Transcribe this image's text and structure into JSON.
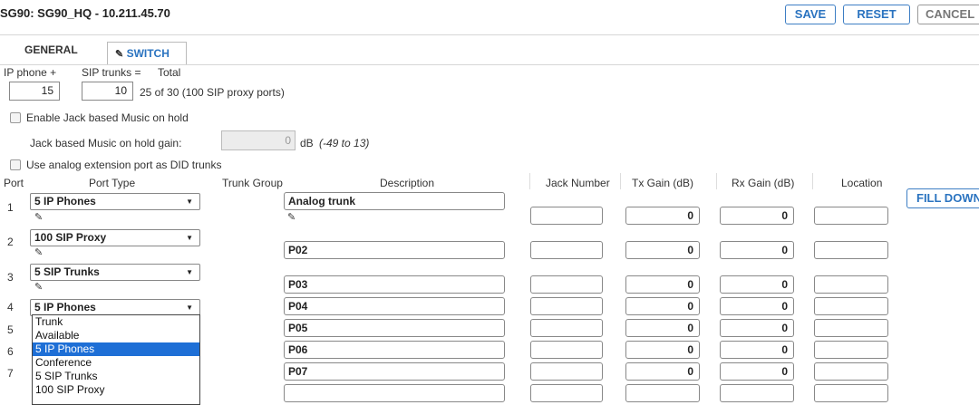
{
  "header": {
    "title": "SG90: SG90_HQ - 10.211.45.70"
  },
  "toolbar": {
    "save": "SAVE",
    "reset": "RESET",
    "cancel": "CANCEL"
  },
  "tabs": {
    "general": "GENERAL",
    "switch": "SWITCH"
  },
  "capacity": {
    "ip_phone_label": "IP phone +",
    "sip_trunks_label": "SIP trunks =",
    "total_label": "Total",
    "ip_phone_value": "15",
    "sip_trunks_value": "10",
    "total_text": "25 of 30 (100 SIP proxy ports)"
  },
  "options": {
    "jack_moh": "Enable Jack based Music on hold",
    "jack_moh_gain_label": "Jack based Music on hold gain:",
    "jack_moh_gain_value": "0",
    "db_unit": "dB",
    "db_range": "(-49 to 13)",
    "analog_did": "Use analog extension port as DID trunks"
  },
  "columns": {
    "port": "Port",
    "port_type": "Port Type",
    "trunk_group": "Trunk Group",
    "description": "Description",
    "jack_number": "Jack Number",
    "tx_gain": "Tx Gain (dB)",
    "rx_gain": "Rx Gain (dB)",
    "location": "Location"
  },
  "fill_down": "FILL DOWN",
  "rows": [
    {
      "port": "1",
      "type": "5 IP Phones",
      "description": "Analog trunk",
      "tx": "0",
      "rx": "0"
    },
    {
      "port": "2",
      "type": "100 SIP Proxy",
      "description": "P02",
      "tx": "0",
      "rx": "0"
    },
    {
      "port": "3",
      "type": "5 SIP Trunks",
      "description": "P03",
      "tx": "0",
      "rx": "0"
    },
    {
      "port": "4",
      "type": "5 IP Phones",
      "description": "P04",
      "tx": "0",
      "rx": "0"
    },
    {
      "port": "5",
      "description": "P05",
      "tx": "0",
      "rx": "0"
    },
    {
      "port": "6",
      "description": "P06",
      "tx": "0",
      "rx": "0"
    },
    {
      "port": "7",
      "description": "P07",
      "tx": "0",
      "rx": "0"
    }
  ],
  "dropdown": {
    "options": [
      "Trunk",
      "Available",
      "5 IP Phones",
      "Conference",
      "5 SIP Trunks",
      "100 SIP Proxy"
    ],
    "selected": "5 IP Phones"
  }
}
